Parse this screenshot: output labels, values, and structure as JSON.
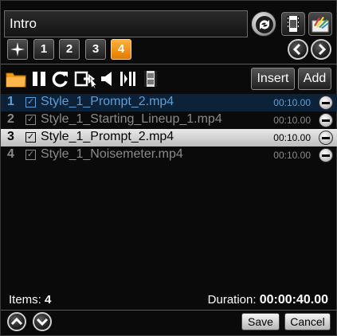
{
  "header": {
    "title_value": "Intro",
    "buttons": [
      {
        "name": "sync-icon"
      },
      {
        "name": "video-clip-icon"
      },
      {
        "name": "palette-icon"
      }
    ]
  },
  "pages": {
    "star_icon": "star-icon",
    "tabs": [
      "1",
      "2",
      "3",
      "4"
    ],
    "active_tab": "4",
    "prev_label": "‹",
    "next_label": "›"
  },
  "toolbar": {
    "tools": [
      "folder-icon",
      "pause-icon",
      "repeat-icon",
      "next-clip-icon",
      "mute-icon",
      "split-icon",
      "film-icon"
    ],
    "insert_label": "Insert",
    "add_label": "Add"
  },
  "playlist": {
    "items": [
      {
        "num": "1",
        "check": "☑",
        "name": "Style_1_Prompt_2.mp4",
        "duration": "00:10.00",
        "state": "cue"
      },
      {
        "num": "2",
        "check": "☑",
        "name": "Style_1_Starting_Lineup_1.mp4",
        "duration": "00:10.00",
        "state": "played"
      },
      {
        "num": "3",
        "check": "☑",
        "name": "Style_1_Prompt_2.mp4",
        "duration": "00:10.00",
        "state": "current"
      },
      {
        "num": "4",
        "check": "☑",
        "name": "Style_1_Noisemeter.mp4",
        "duration": "00:10.00",
        "state": "pending"
      }
    ]
  },
  "footer": {
    "items_label": "Items:",
    "items_count": "4",
    "duration_label": "Duration:",
    "duration_value": "00:00:40.00",
    "save_label": "Save",
    "cancel_label": "Cancel"
  },
  "colors": {
    "active_tab": "#f0961c",
    "cue_text": "#5d9fd9",
    "current_row": "#d6d6d6"
  }
}
